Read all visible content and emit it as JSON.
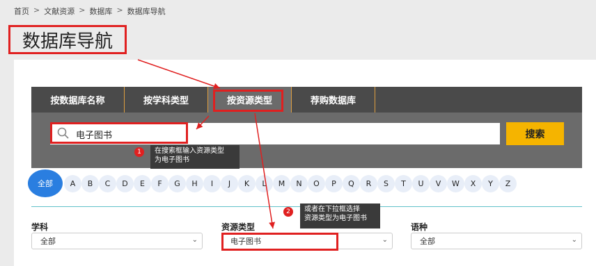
{
  "breadcrumb": [
    "首页",
    "文献资源",
    "数据库",
    "数据库导航"
  ],
  "breadcrumb_sep": ">",
  "page_title": "数据库导航",
  "tabs": [
    "按数据库名称",
    "按学科类型",
    "按资源类型",
    "荐购数据库"
  ],
  "search": {
    "value": "电子图书",
    "button": "搜索"
  },
  "tips": [
    {
      "step": "1",
      "line1": "在搜索框输入资源类型",
      "line2": "为电子图书"
    },
    {
      "step": "2",
      "line1": "或者在下拉框选择",
      "line2": "资源类型为电子图书"
    }
  ],
  "letters": {
    "all": "全部",
    "items": [
      "A",
      "B",
      "C",
      "D",
      "E",
      "F",
      "G",
      "H",
      "I",
      "J",
      "K",
      "L",
      "M",
      "N",
      "O",
      "P",
      "Q",
      "R",
      "S",
      "T",
      "U",
      "V",
      "W",
      "X",
      "Y",
      "Z"
    ]
  },
  "filters": [
    {
      "label": "学科",
      "value": "全部"
    },
    {
      "label": "资源类型",
      "value": "电子图书"
    },
    {
      "label": "语种",
      "value": "全部"
    }
  ],
  "colors": {
    "highlight": "#e02020",
    "accent_button": "#f5b400",
    "active_letter": "#2a7ee0",
    "tab_bar": "#4a4a4a"
  }
}
